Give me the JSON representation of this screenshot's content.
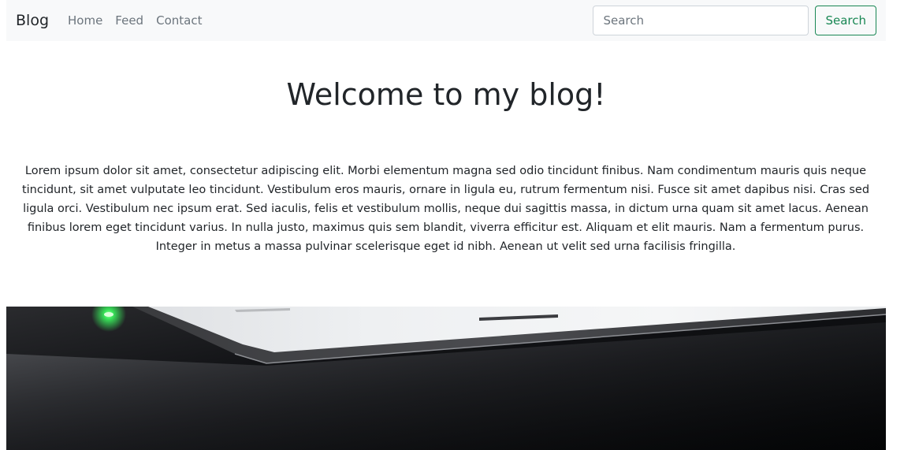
{
  "navbar": {
    "brand": "Blog",
    "links": [
      "Home",
      "Feed",
      "Contact"
    ],
    "search": {
      "placeholder": "Search",
      "value": "",
      "button_label": "Search"
    }
  },
  "main": {
    "title": "Welcome to my blog!",
    "intro": "Lorem ipsum dolor sit amet, consectetur adipiscing elit. Morbi elementum magna sed odio tincidunt finibus. Nam condimentum mauris quis neque tincidunt, sit amet vulputate leo tincidunt. Vestibulum eros mauris, ornare in ligula eu, rutrum fermentum nisi. Fusce sit amet dapibus nisi. Cras sed ligula orci. Vestibulum nec ipsum erat. Sed iaculis, felis et vestibulum mollis, neque dui sagittis massa, in dictum urna quam sit amet lacus. Aenean finibus lorem eget tincidunt varius. In nulla justo, maximus quis sem blandit, viverra efficitur est. Aliquam et elit mauris. Nam a fermentum purus. Integer in metus a massa pulvinar scelerisque eget id nibh. Aenean ut velit sed urna facilisis fringilla."
  },
  "colors": {
    "navbar_bg": "#f8f9fa",
    "success": "#198754",
    "muted_link": "#6c757d",
    "text": "#212529"
  }
}
